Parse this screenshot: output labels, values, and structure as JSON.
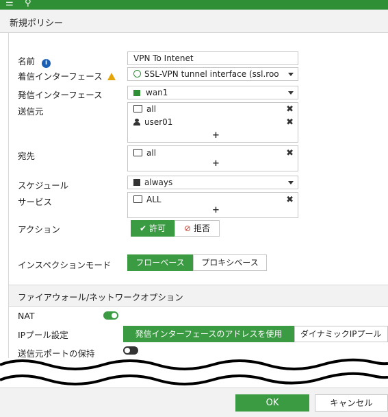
{
  "header": {
    "title": "新規ポリシー",
    "menu_icon": "hamburger-icon",
    "search_icon": "search-icon"
  },
  "form": {
    "name_label": "名前",
    "name_value": "VPN To Intenet",
    "incoming_label": "着信インターフェース",
    "incoming_value": "SSL-VPN tunnel interface (ssl.roo",
    "outgoing_label": "発信インターフェース",
    "outgoing_value": "wan1",
    "source_label": "送信元",
    "source_items": [
      "all",
      "user01"
    ],
    "destination_label": "宛先",
    "destination_items": [
      "all"
    ],
    "schedule_label": "スケジュール",
    "schedule_value": "always",
    "service_label": "サービス",
    "service_items": [
      "ALL"
    ],
    "add_symbol": "+",
    "remove_symbol": "✖",
    "action_label": "アクション",
    "action_accept": "許可",
    "action_deny": "拒否",
    "inspection_label": "インスペクションモード",
    "inspection_flow": "フローベース",
    "inspection_proxy": "プロキシベース"
  },
  "firewall": {
    "section_title": "ファイアウォール/ネットワークオプション",
    "nat_label": "NAT",
    "nat_enabled": true,
    "ippool_label": "IPプール設定",
    "ippool_outgoing": "発信インターフェースのアドレスを使用",
    "ippool_dynamic": "ダイナミックIPプール",
    "preserve_port_label": "送信元ポートの保持",
    "preserve_port_enabled": false
  },
  "footer": {
    "ok": "OK",
    "cancel": "キャンセル"
  },
  "colors": {
    "accent": "#3a9b42",
    "topbar": "#2f8f35",
    "info": "#1a5fb4",
    "warning": "#e5a50a",
    "deny": "#c0392b"
  }
}
